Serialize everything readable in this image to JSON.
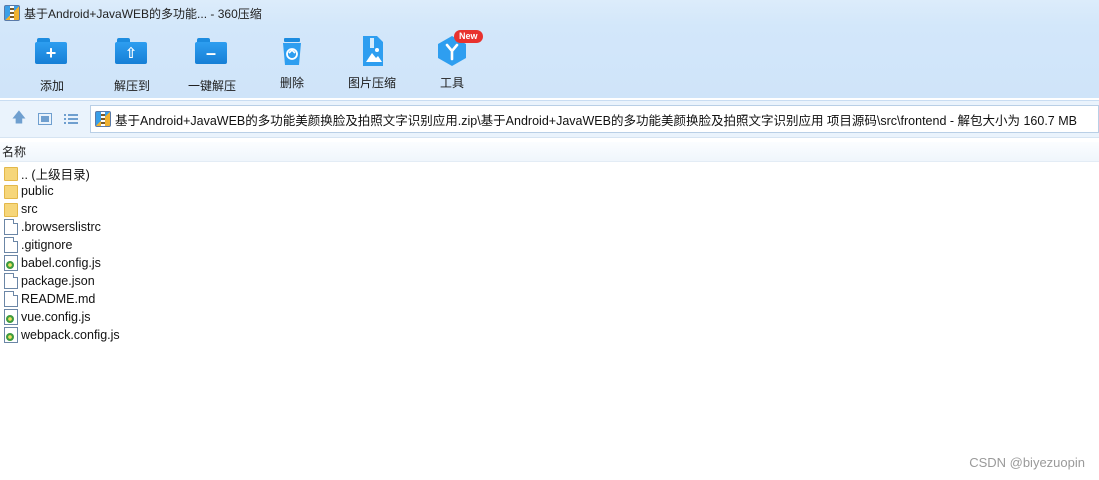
{
  "window": {
    "title": "基于Android+JavaWEB的多功能... - 360压缩"
  },
  "toolbar": {
    "items": [
      {
        "label": "添加",
        "icon": "add-folder-icon"
      },
      {
        "label": "解压到",
        "icon": "extract-to-icon"
      },
      {
        "label": "一键解压",
        "icon": "one-click-extract-icon"
      },
      {
        "label": "删除",
        "icon": "trash-icon"
      },
      {
        "label": "图片压缩",
        "icon": "image-compress-icon"
      },
      {
        "label": "工具",
        "icon": "tools-icon",
        "badge": "New"
      }
    ]
  },
  "navbar": {
    "address": "基于Android+JavaWEB的多功能美颜换脸及拍照文字识别应用.zip\\基于Android+JavaWEB的多功能美颜换脸及拍照文字识别应用 项目源码\\src\\frontend - 解包大小为 160.7 MB"
  },
  "list": {
    "column_name": "名称",
    "files": [
      {
        "name": ".. (上级目录)",
        "type": "folder"
      },
      {
        "name": "public",
        "type": "folder"
      },
      {
        "name": "src",
        "type": "folder"
      },
      {
        "name": ".browserslistrc",
        "type": "doc"
      },
      {
        "name": ".gitignore",
        "type": "doc"
      },
      {
        "name": "babel.config.js",
        "type": "js"
      },
      {
        "name": "package.json",
        "type": "doc"
      },
      {
        "name": "README.md",
        "type": "doc"
      },
      {
        "name": "vue.config.js",
        "type": "js"
      },
      {
        "name": "webpack.config.js",
        "type": "js"
      }
    ]
  },
  "watermark": "CSDN @biyezuopin",
  "colors": {
    "titlebar": "#d3e7fa",
    "accent": "#1c8ce0",
    "badge": "#e8322e",
    "folder": "#f6d67a"
  }
}
